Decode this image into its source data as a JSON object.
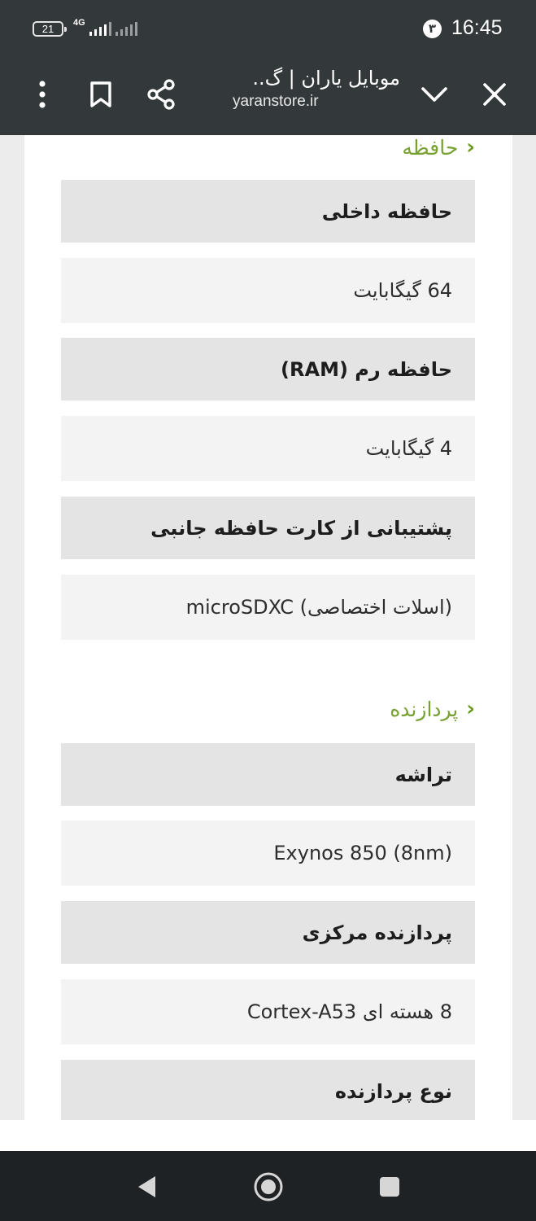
{
  "status_bar": {
    "battery": "21",
    "network": "4G",
    "notification_badge": "۳",
    "time": "16:45"
  },
  "toolbar": {
    "title": "موبایل یاران | گ..",
    "url": "yaranstore.ir",
    "icons": [
      "menu-icon",
      "bookmark-icon",
      "share-icon",
      "chevron-down-icon",
      "close-icon"
    ]
  },
  "sections": [
    {
      "title": "حافظه",
      "rows": [
        {
          "label": "حافظه داخلی",
          "value": "64 گیگابایت"
        },
        {
          "label": "حافظه رم (RAM)",
          "value": "4 گیگابایت"
        },
        {
          "label": "پشتیبانی از کارت حافظه جانبی",
          "value": "microSDXC (اسلات اختصاصی)"
        }
      ]
    },
    {
      "title": "پردازنده",
      "rows": [
        {
          "label": "تراشه",
          "value": "Exynos 850 (8nm)"
        },
        {
          "label": "پردازنده مرکزی",
          "value": "8 هسته ای Cortex-A53"
        },
        {
          "label": "نوع پردازنده",
          "value": ""
        }
      ]
    }
  ],
  "colors": {
    "bar_background": "#33383b",
    "accent_green": "#77a132",
    "label_background": "#e4e4e4",
    "value_background": "#f3f3f3"
  }
}
